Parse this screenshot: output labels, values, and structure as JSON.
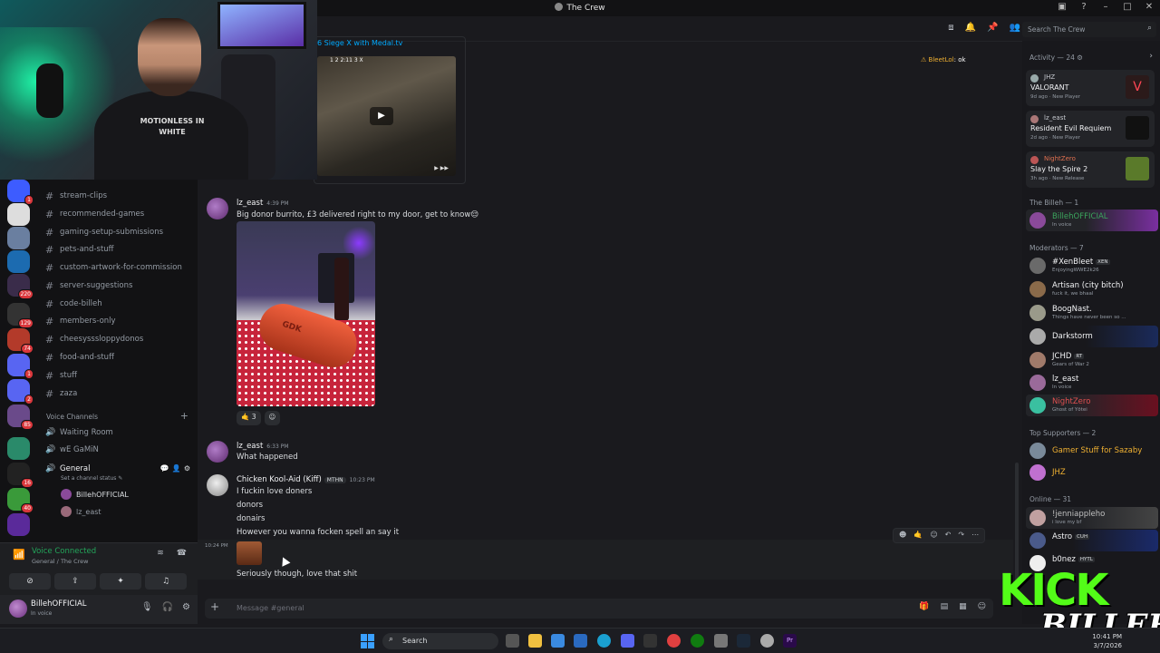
{
  "window": {
    "title": "The Crew"
  },
  "search": {
    "placeholder": "Search The Crew"
  },
  "channels": [
    "stream-clips",
    "recommended-games",
    "gaming-setup-submissions",
    "pets-and-stuff",
    "custom-artwork-for-commission",
    "server-suggestions",
    "code-billeh",
    "members-only",
    "cheesysssloppydonos",
    "food-and-stuff",
    "stuff",
    "zaza"
  ],
  "voice": {
    "header": "Voice Channels",
    "channels": [
      "Waiting Room",
      "wE GaMiN",
      "General"
    ],
    "status_placeholder": "Set a channel status",
    "users": [
      "BillehOFFICIAL",
      "lz_east"
    ]
  },
  "server_badges": [
    "1",
    "220",
    "129",
    "74",
    "1",
    "2",
    "85",
    "16",
    "40"
  ],
  "voice_panel": {
    "title": "Voice Connected",
    "subtitle": "General / The Crew"
  },
  "user_panel": {
    "name": "BillehOFFICIAL",
    "status": "In voice"
  },
  "embed": {
    "title": "6 Siege X with Medal.tv",
    "hud": "1 2 2:11 3 X",
    "hud2": "▶ ▶▶"
  },
  "ping": {
    "name": "BleetLol",
    "text": ": ok"
  },
  "messages": [
    {
      "author": "lz_east",
      "time": "4:39 PM",
      "text": "Big donor burrito, £3 delivered right to my door, get to know😌"
    },
    {
      "author": "lz_east",
      "time": "6:33 PM",
      "text": "What happened"
    },
    {
      "author": "Chicken Kool-Aid (Kiff)",
      "role": "MTHN",
      "time": "10:23 PM",
      "lines": [
        "I fuckin love doners",
        "donors",
        "donairs",
        "However you wanna focken spell an say it"
      ]
    },
    {
      "time": "10:24 PM",
      "text": "Seriously though, love that shit"
    }
  ],
  "photo": {
    "label": "GDK"
  },
  "reaction": {
    "emoji": "🤙",
    "count": "3"
  },
  "composer": {
    "placeholder": "Message #general"
  },
  "activity": {
    "header": "Activity — 24",
    "cards": [
      {
        "user": "JHZ",
        "game": "VALORANT",
        "meta": "9d ago · New Player",
        "color": "#ff4655"
      },
      {
        "user": "lz_east",
        "game": "Resident Evil Requiem",
        "meta": "2d ago · New Player",
        "color": "#1a1a1a"
      },
      {
        "user": "NightZero",
        "game": "Slay the Spire 2",
        "meta": "3h ago · New Release",
        "color": "#4a6a2a"
      }
    ]
  },
  "member_sections": {
    "owner": "The Billeh — 1",
    "mods": "Moderators — 7",
    "supporters": "Top Supporters — 2",
    "online": "Online — 31"
  },
  "members": {
    "owner": [
      {
        "name": "BillehOFFICIAL",
        "status": "In voice"
      }
    ],
    "mods": [
      {
        "name": "#XenBleet",
        "tag": "XEN",
        "status": "EnjoyingWWE2k26"
      },
      {
        "name": "Artisan (city bitch)",
        "status": "fuck it, we bhaal"
      },
      {
        "name": "BoogNast.",
        "status": "Things have never been so ..."
      },
      {
        "name": "Darkstorm",
        "status": ""
      },
      {
        "name": "JCHD",
        "tag": "RT",
        "status": "Gears of War 2"
      },
      {
        "name": "lz_east",
        "status": "In voice"
      },
      {
        "name": "NightZero",
        "status": "Ghost of Yōtei"
      }
    ],
    "supporters": [
      {
        "name": "Gamer Stuff for Sazaby"
      },
      {
        "name": "JHZ"
      }
    ],
    "online": [
      {
        "name": "!jenniappleho",
        "status": "i love my bf"
      },
      {
        "name": "Astro",
        "tag": "CUH",
        "status": ""
      },
      {
        "name": "b0nez",
        "tag": "HYTL",
        "status": ""
      }
    ]
  },
  "webcam": {
    "shirt": "MOTIONLESS IN WHITE"
  },
  "overlay": {
    "brand": "KICK",
    "name": "BILLEH"
  },
  "taskbar": {
    "search": "Search",
    "clock_time": "10:41 PM",
    "clock_date": "3/7/2026"
  }
}
